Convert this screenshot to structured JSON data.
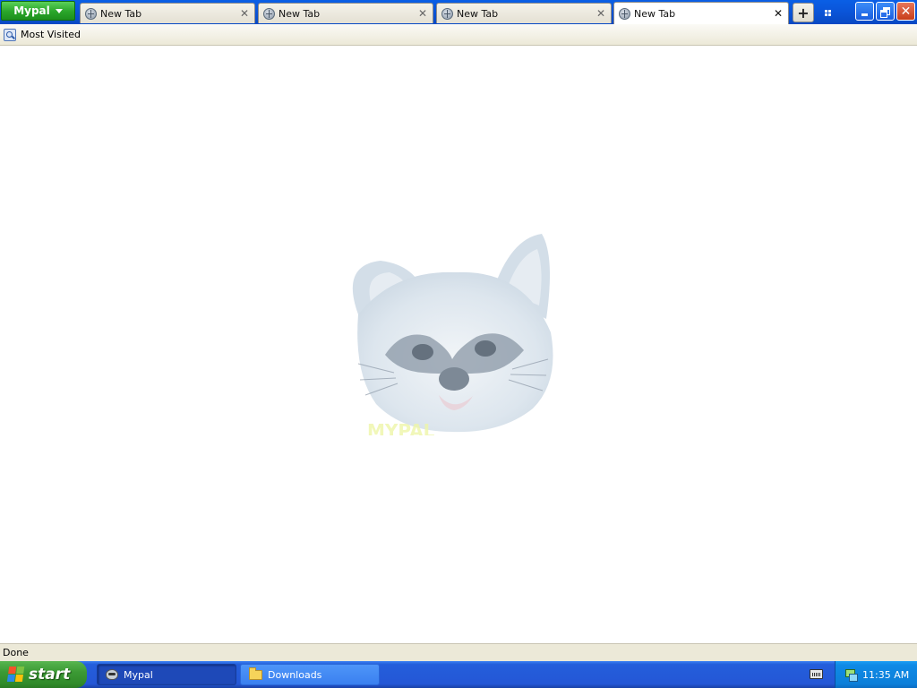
{
  "browser": {
    "menu_button": "Mypal",
    "tabs": [
      {
        "label": "New Tab",
        "active": false
      },
      {
        "label": "New Tab",
        "active": false
      },
      {
        "label": "New Tab",
        "active": false
      },
      {
        "label": "New Tab",
        "active": true
      }
    ],
    "new_tab_symbol": "+",
    "bookmarks": [
      {
        "label": "Most Visited",
        "icon": "search-bookmark-icon"
      }
    ],
    "content": {
      "mascot_icon": "raccoon-icon",
      "mascot_text": "MYPAL"
    },
    "status": "Done"
  },
  "taskbar": {
    "start_label": "start",
    "buttons": [
      {
        "label": "Mypal",
        "icon": "raccoon-icon",
        "active": true
      },
      {
        "label": "Downloads",
        "icon": "folder-icon",
        "active": false
      }
    ],
    "clock": "11:35 AM"
  },
  "colors": {
    "titlebar_blue": "#0a54d8",
    "menu_green": "#2aa52a",
    "taskbar_blue": "#245edb",
    "tray_blue": "#0f8ae6",
    "close_red": "#c83d1b"
  }
}
